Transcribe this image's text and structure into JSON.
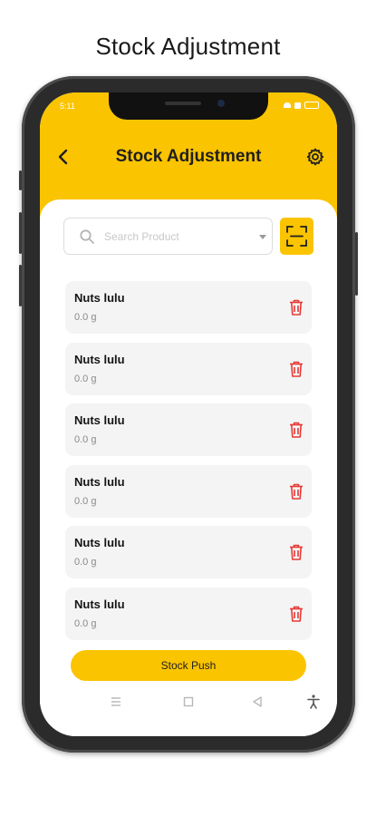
{
  "caption": "Stock Adjustment",
  "status_bar": {
    "time": "5:11"
  },
  "header": {
    "title": "Stock Adjustment",
    "back_icon": "chevron-left-icon",
    "settings_icon": "gear-icon"
  },
  "search": {
    "placeholder": "Search Product",
    "value": ""
  },
  "scan_button": {
    "icon": "barcode-scan-icon"
  },
  "items": [
    {
      "name": "Nuts lulu",
      "qty": "0.0 g"
    },
    {
      "name": "Nuts lulu",
      "qty": "0.0 g"
    },
    {
      "name": "Nuts lulu",
      "qty": "0.0 g"
    },
    {
      "name": "Nuts lulu",
      "qty": "0.0 g"
    },
    {
      "name": "Nuts lulu",
      "qty": "0.0 g"
    },
    {
      "name": "Nuts lulu",
      "qty": "0.0 g"
    }
  ],
  "push_button": {
    "label": "Stock Push"
  },
  "nav_icons": [
    "menu-icon",
    "square-icon",
    "back-triangle-icon",
    "accessibility-icon"
  ],
  "colors": {
    "accent": "#FBC400",
    "delete": "#E53935",
    "card": "#F4F4F4"
  }
}
